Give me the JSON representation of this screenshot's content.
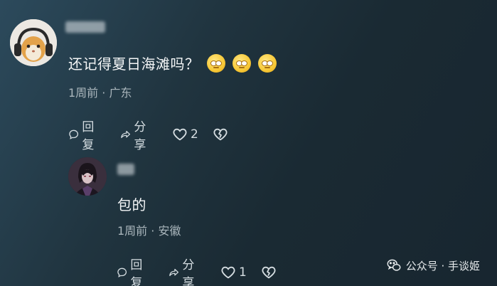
{
  "comments": [
    {
      "username_blurred": "",
      "text": "还记得夏日海滩吗？",
      "emoji_count": 3,
      "emoji_name": "eye-roll-emoji",
      "time": "1周前",
      "separator": "·",
      "location": "广东",
      "reply_label": "回复",
      "share_label": "分享",
      "like_count": "2"
    },
    {
      "username_blurred": "",
      "text": "包的",
      "time": "1周前",
      "separator": "·",
      "location": "安徽",
      "reply_label": "回复",
      "share_label": "分享",
      "like_count": "1"
    }
  ],
  "watermark": {
    "icon": "wechat-icon",
    "text": "公众号 · 手谈姬"
  },
  "colors": {
    "bg_dark": "#182630",
    "bg_light": "#2c4a5c",
    "text": "#f4f6f7",
    "meta": "#aab6bc",
    "emoji": "#f7c836"
  }
}
